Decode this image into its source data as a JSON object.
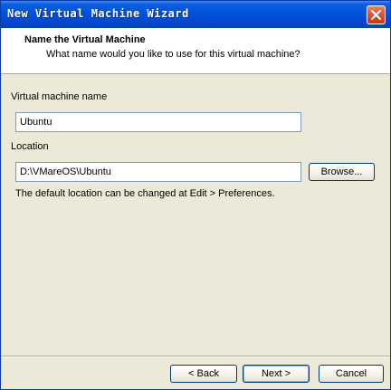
{
  "window": {
    "title": "New Virtual Machine Wizard"
  },
  "header": {
    "title": "Name the Virtual Machine",
    "subtitle": "What name would you like to use for this virtual machine?"
  },
  "form": {
    "vm_name_label": "Virtual machine name",
    "vm_name_value": "Ubuntu",
    "location_label": "Location",
    "location_value": "D:\\VMareOS\\Ubuntu",
    "browse_label": "Browse...",
    "hint": "The default location can be changed at Edit > Preferences."
  },
  "footer": {
    "back_label": "< Back",
    "next_label": "Next >",
    "cancel_label": "Cancel"
  },
  "icons": {
    "close": "close-icon"
  },
  "colors": {
    "titlebar": "#0052d9",
    "body": "#ece9d8",
    "close": "#d9532e"
  }
}
